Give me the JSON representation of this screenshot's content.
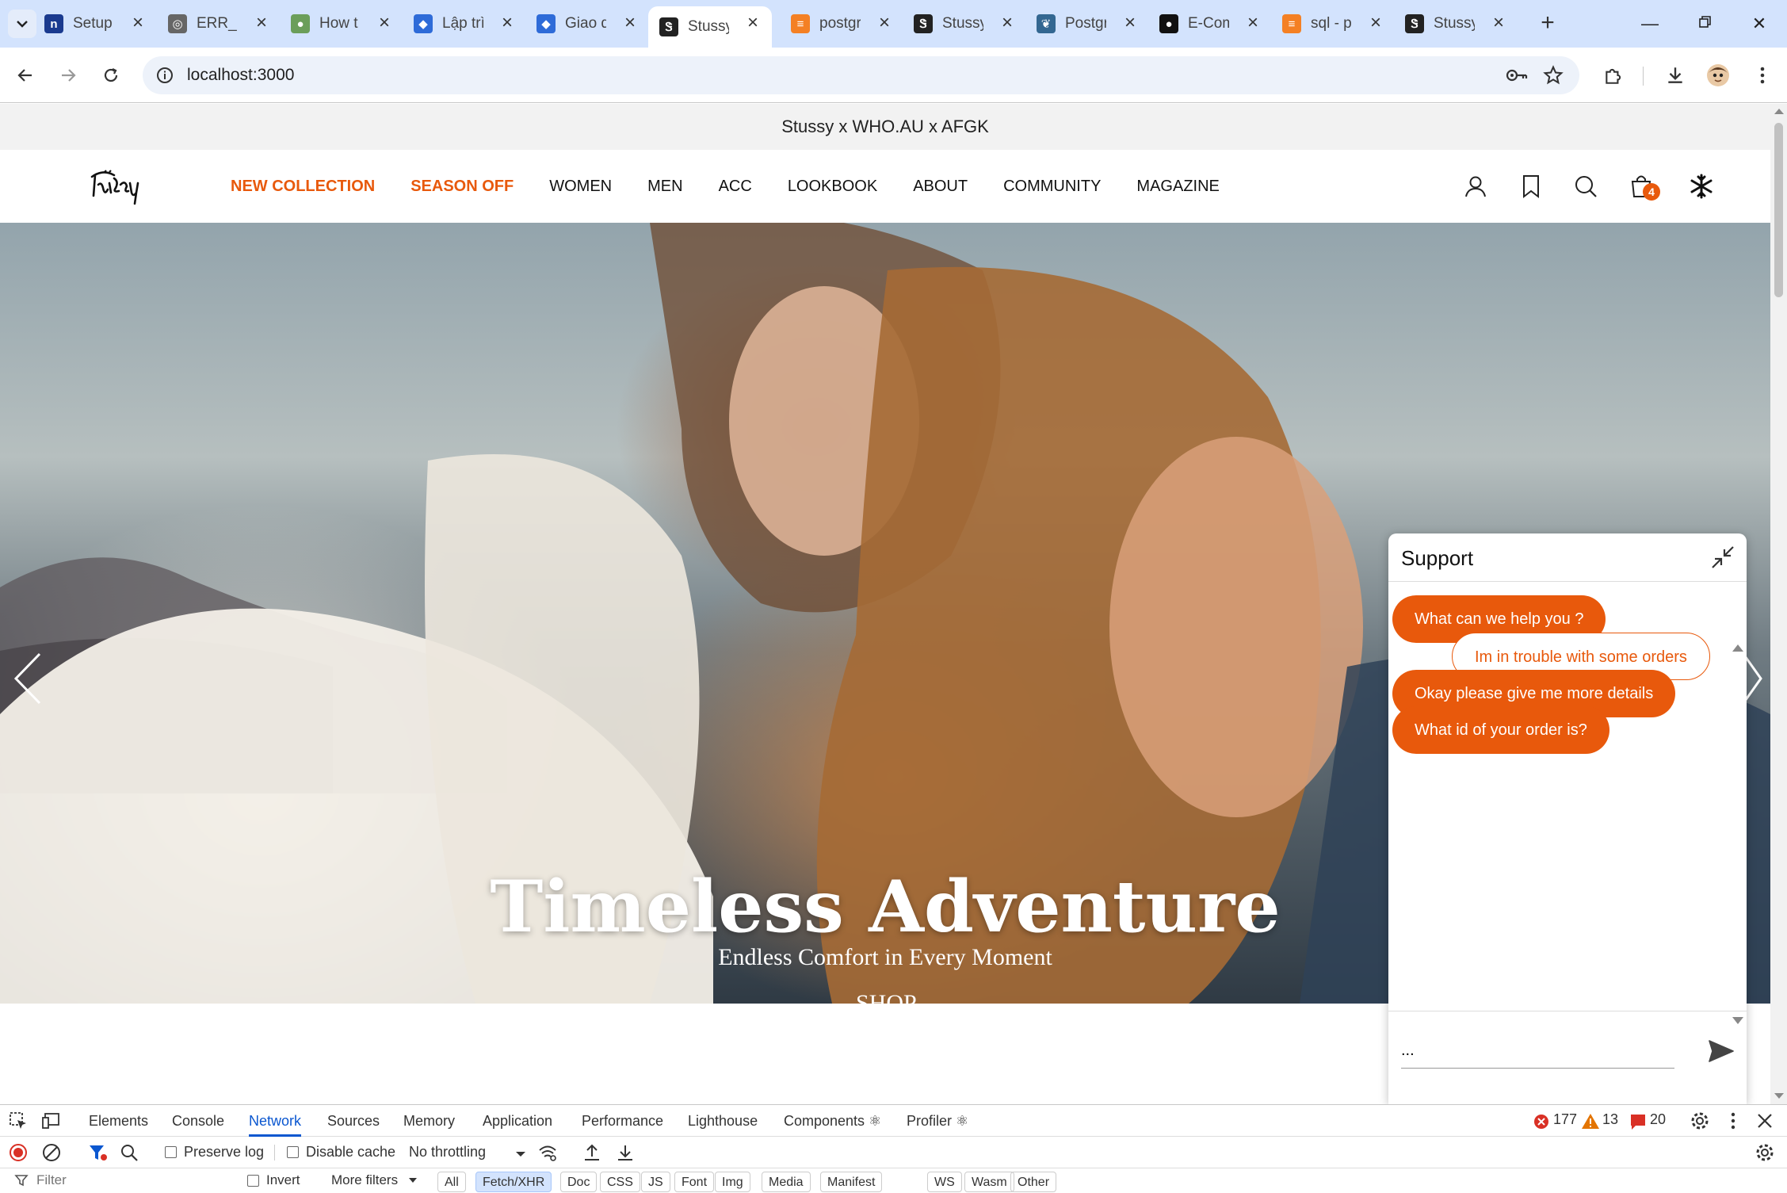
{
  "browser": {
    "tabs": [
      {
        "title": "Setup",
        "favicon": "n-logo-icon",
        "color": "#1a3a8f",
        "glyph": "n"
      },
      {
        "title": "ERR_N",
        "favicon": "globe-icon",
        "color": "#666666",
        "glyph": "◎"
      },
      {
        "title": "How t",
        "favicon": "ai-assistant-icon",
        "color": "#6b9e5a",
        "glyph": "●"
      },
      {
        "title": "Lập trì",
        "favicon": "diamond-logo-icon",
        "color": "#2e6bd8",
        "glyph": "◆"
      },
      {
        "title": "Giao d",
        "favicon": "diamond-logo-icon",
        "color": "#2e6bd8",
        "glyph": "◆"
      },
      {
        "title": "Stussy",
        "favicon": "stussy-logo-icon",
        "color": "#222222",
        "glyph": "Ꮥ",
        "active": true
      },
      {
        "title": "postgr",
        "favicon": "stackoverflow-icon",
        "color": "#f48024",
        "glyph": "≡"
      },
      {
        "title": "Stussy",
        "favicon": "stussy-logo-icon",
        "color": "#222222",
        "glyph": "Ꮥ"
      },
      {
        "title": "Postgr",
        "favicon": "postgresql-icon",
        "color": "#336791",
        "glyph": "❦"
      },
      {
        "title": "E-Com",
        "favicon": "github-icon",
        "color": "#111111",
        "glyph": "●"
      },
      {
        "title": "sql - p",
        "favicon": "stackoverflow-icon",
        "color": "#f48024",
        "glyph": "≡"
      },
      {
        "title": "Stussy",
        "favicon": "stussy-logo-icon",
        "color": "#222222",
        "glyph": "Ꮥ"
      }
    ],
    "url": "localhost:3000"
  },
  "site": {
    "announcement": "Stussy x WHO.AU x AFGK",
    "nav": [
      {
        "label": "NEW COLLECTION",
        "highlight": true
      },
      {
        "label": "SEASON OFF",
        "highlight": true
      },
      {
        "label": "WOMEN"
      },
      {
        "label": "MEN"
      },
      {
        "label": "ACC"
      },
      {
        "label": "LOOKBOOK"
      },
      {
        "label": "ABOUT"
      },
      {
        "label": "COMMUNITY"
      },
      {
        "label": "MAGAZINE"
      }
    ],
    "cart_count": "4",
    "accent_color": "#e8590c",
    "hero": {
      "title": "Timeless Adventure",
      "subtitle": "Endless Comfort in Every Moment",
      "cta": "SHOP"
    }
  },
  "support": {
    "title": "Support",
    "messages": [
      {
        "from": "bot",
        "text": "What can we help you ?"
      },
      {
        "from": "user",
        "text": "Im in trouble with some orders"
      },
      {
        "from": "bot",
        "text": "Okay please give me more details"
      },
      {
        "from": "bot",
        "text": "What id of your order is?"
      }
    ],
    "input_value": "..."
  },
  "devtools": {
    "tabs": [
      "Elements",
      "Console",
      "Network",
      "Sources",
      "Memory",
      "Application",
      "Performance",
      "Lighthouse",
      "Components ⚛",
      "Profiler ⚛"
    ],
    "active_tab": "Network",
    "errors": "177",
    "warnings": "13",
    "issues": "20",
    "preserve_log": "Preserve log",
    "disable_cache": "Disable cache",
    "throttling": "No throttling",
    "filter_placeholder": "Filter",
    "invert": "Invert",
    "more_filters": "More filters",
    "type_filters": [
      "All",
      "Fetch/XHR",
      "Doc",
      "CSS",
      "JS",
      "Font",
      "Img",
      "Media",
      "Manifest",
      "WS",
      "Wasm",
      "Other"
    ],
    "active_type_filter": "Fetch/XHR"
  }
}
